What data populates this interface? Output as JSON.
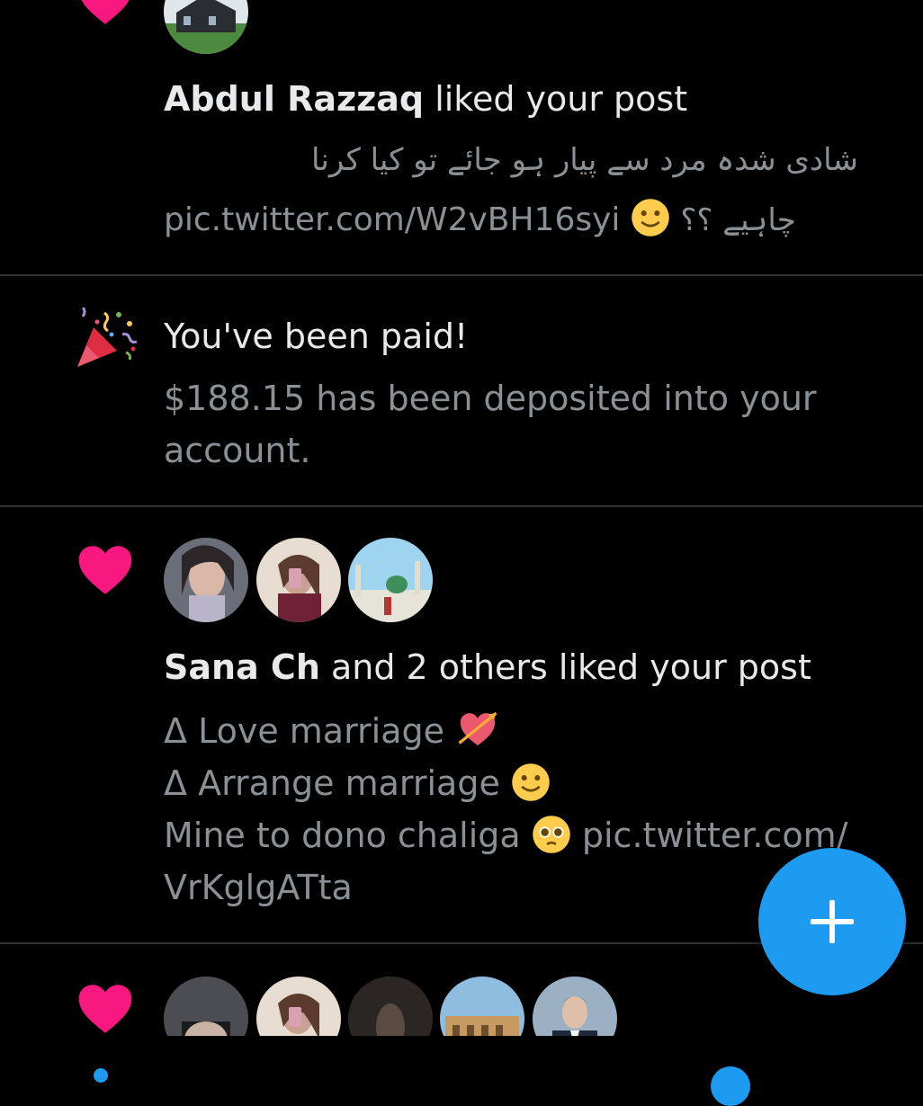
{
  "notifications": [
    {
      "type": "like",
      "user": "Abdul Razzaq",
      "action": " liked your post",
      "text_line1": "شادی شدہ مرد سے پیار ہو جائے تو کیا کرنا",
      "text_line2_prefix": "pic.twitter.com/W2vBH16syi",
      "text_line2_suffix": "چاہیے ؟؟"
    },
    {
      "type": "payout",
      "title": "You've been paid!",
      "body_line1": "$188.15 has been deposited into your",
      "body_line2": "account."
    },
    {
      "type": "like",
      "user": "Sana Ch",
      "action": " and 2 others liked your post",
      "line1": "Δ Love marriage",
      "line2": "Δ Arrange marriage",
      "line3": "Mine to dono chaliga",
      "line3_link": "pic.twitter.com/",
      "line4": "VrKglgATta"
    },
    {
      "type": "like"
    }
  ],
  "fab": {
    "icon": "plus-icon"
  },
  "colors": {
    "background": "#000000",
    "heart": "#f91880",
    "accent": "#1d9bf0",
    "text_primary": "#e7e9ea",
    "text_secondary": "#8b9095"
  }
}
